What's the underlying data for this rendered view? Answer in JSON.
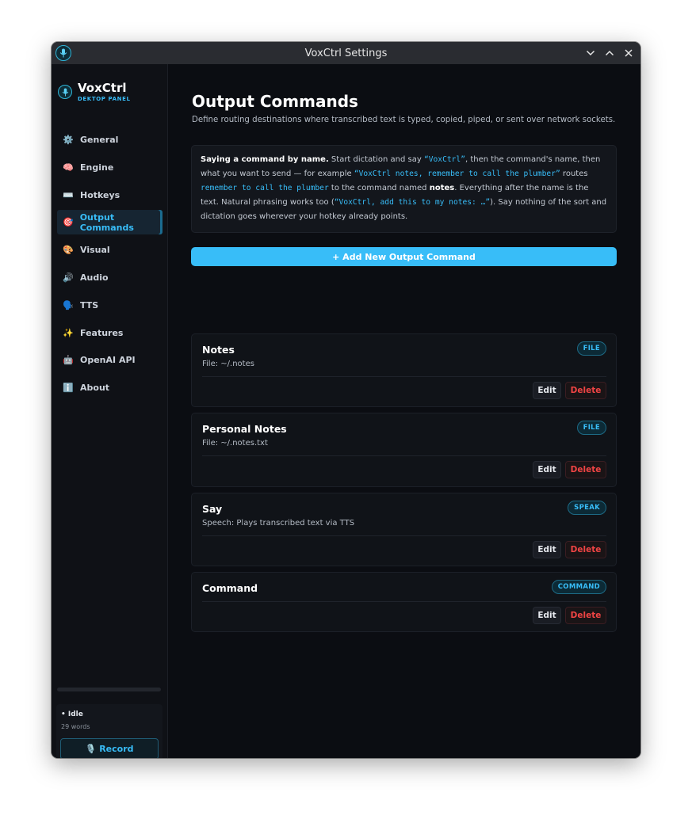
{
  "window": {
    "title": "VoxCtrl Settings",
    "controls": [
      {
        "icon": "chevron-down-icon"
      },
      {
        "icon": "chevron-up-icon"
      },
      {
        "icon": "close-icon"
      }
    ]
  },
  "brand": {
    "name": "VoxCtrl",
    "subtitle": "DEKTOP PANEL",
    "icon": "microphone-icon"
  },
  "sidebar": {
    "items": [
      {
        "label": "General",
        "icon": "⚙️",
        "icon_name": "gear-icon",
        "active": false
      },
      {
        "label": "Engine",
        "icon": "🧠",
        "icon_name": "brain-icon",
        "active": false
      },
      {
        "label": "Hotkeys",
        "icon": "⌨️",
        "icon_name": "keyboard-icon",
        "active": false
      },
      {
        "label": "Output Commands",
        "icon": "🎯",
        "icon_name": "target-icon",
        "active": true
      },
      {
        "label": "Visual",
        "icon": "🎨",
        "icon_name": "palette-icon",
        "active": false
      },
      {
        "label": "Audio",
        "icon": "🔊",
        "icon_name": "speaker-icon",
        "active": false
      },
      {
        "label": "TTS",
        "icon": "🗣️",
        "icon_name": "speaking-head-icon",
        "active": false
      },
      {
        "label": "Features",
        "icon": "✨",
        "icon_name": "sparkles-icon",
        "active": false
      },
      {
        "label": "OpenAI API",
        "icon": "🤖",
        "icon_name": "robot-icon",
        "active": false
      },
      {
        "label": "About",
        "icon": "ℹ️",
        "icon_name": "info-icon",
        "active": false
      }
    ],
    "status": {
      "state": "Idle",
      "words": "29 words",
      "record_label": "Record",
      "record_icon": "🎙️"
    }
  },
  "main": {
    "title": "Output Commands",
    "description": "Define routing destinations where transcribed text is typed, copied, piped, or sent over network sockets.",
    "info": {
      "heading": "Saying a command by name.",
      "t1": " Start dictation and say ",
      "c1": "“VoxCtrl”",
      "t2": ", then the command's name, then what you want to send — for example ",
      "c2": "“VoxCtrl notes, remember to call the plumber”",
      "t3": " routes ",
      "c3": "remember to call the plumber",
      "t4": " to the command named ",
      "b1": "notes",
      "t5": ". Everything after the name is the text. Natural phrasing works too (",
      "c4": "“VoxCtrl, add this to my notes: …”",
      "t6": "). Say nothing of the sort and dictation goes wherever your hotkey already points."
    },
    "add_button": "+ Add New Output Command",
    "commands": [
      {
        "name": "Notes",
        "detail": "File: ~/.notes",
        "badge": "FILE",
        "edit": "Edit",
        "delete": "Delete"
      },
      {
        "name": "Personal Notes",
        "detail": "File: ~/.notes.txt",
        "badge": "FILE",
        "edit": "Edit",
        "delete": "Delete"
      },
      {
        "name": "Say",
        "detail": "Speech: Plays transcribed text via TTS",
        "badge": "SPEAK",
        "edit": "Edit",
        "delete": "Delete"
      },
      {
        "name": "Command",
        "detail": "",
        "badge": "COMMAND",
        "edit": "Edit",
        "delete": "Delete"
      }
    ]
  },
  "colors": {
    "accent": "#38bdf8",
    "danger": "#ef4444",
    "background": "#0b0d12",
    "titlebar": "#2a2c31"
  }
}
